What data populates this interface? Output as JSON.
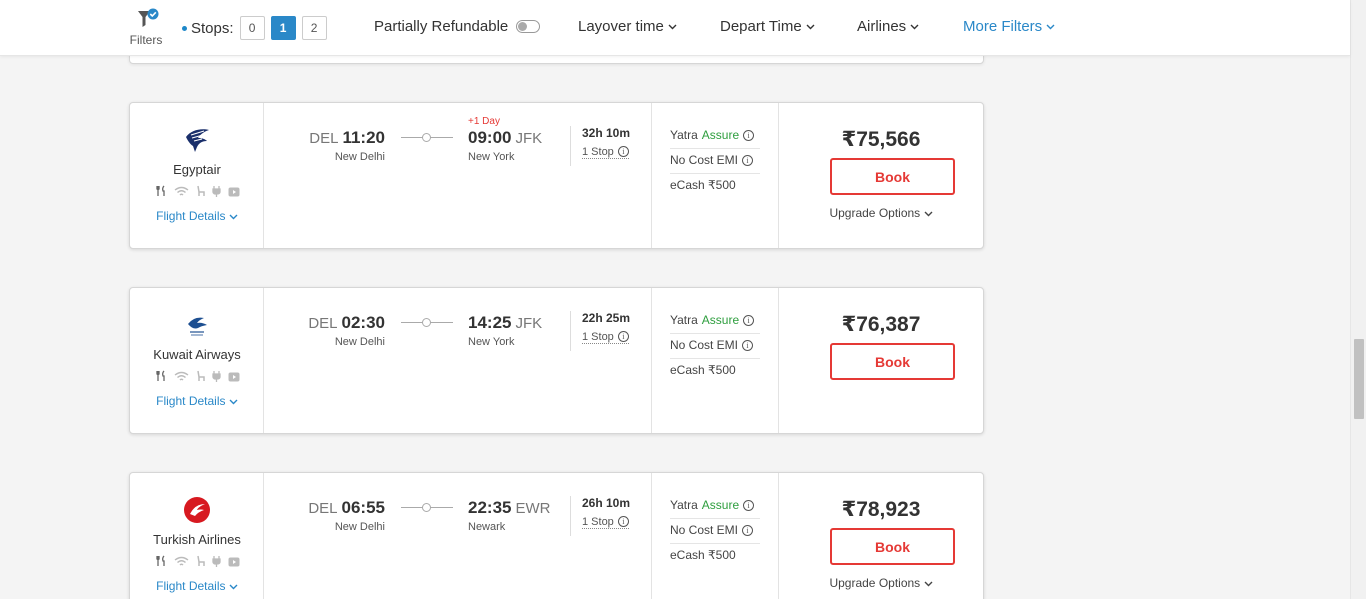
{
  "topbar": {
    "filters_label": "Filters",
    "stops_label": "Stops:",
    "stop_options": [
      "0",
      "1",
      "2"
    ],
    "stop_selected": "1",
    "partially_refundable": "Partially Refundable",
    "layover_time": "Layover time",
    "depart_time": "Depart Time",
    "airlines": "Airlines",
    "more_filters": "More Filters",
    "accent_color": "#2a88c8"
  },
  "labels": {
    "flight_details": "Flight Details",
    "book": "Book",
    "upgrade_options": "Upgrade Options",
    "yatra": "Yatra",
    "assure": "Assure",
    "no_cost_emi": "No Cost EMI",
    "ecash": "eCash ₹500"
  },
  "flights": [
    {
      "airline": "Egyptair",
      "logo": "egyptair-logo",
      "dep_code": "DEL",
      "dep_time": "11:20",
      "dep_city": "New Delhi",
      "arr_code": "JFK",
      "arr_time": "09:00",
      "arr_city": "New York",
      "plus_day": "+1 Day",
      "duration": "32h 10m",
      "stops": "1 Stop",
      "price": "₹75,566",
      "has_upgrade": true
    },
    {
      "airline": "Kuwait Airways",
      "logo": "kuwait-airways-logo",
      "dep_code": "DEL",
      "dep_time": "02:30",
      "dep_city": "New Delhi",
      "arr_code": "JFK",
      "arr_time": "14:25",
      "arr_city": "New York",
      "plus_day": "",
      "duration": "22h 25m",
      "stops": "1 Stop",
      "price": "₹76,387",
      "has_upgrade": false
    },
    {
      "airline": "Turkish Airlines",
      "logo": "turkish-airlines-logo",
      "dep_code": "DEL",
      "dep_time": "06:55",
      "dep_city": "New Delhi",
      "arr_code": "EWR",
      "arr_time": "22:35",
      "arr_city": "Newark",
      "plus_day": "",
      "duration": "26h 10m",
      "stops": "1 Stop",
      "price": "₹78,923",
      "has_upgrade": true
    }
  ]
}
